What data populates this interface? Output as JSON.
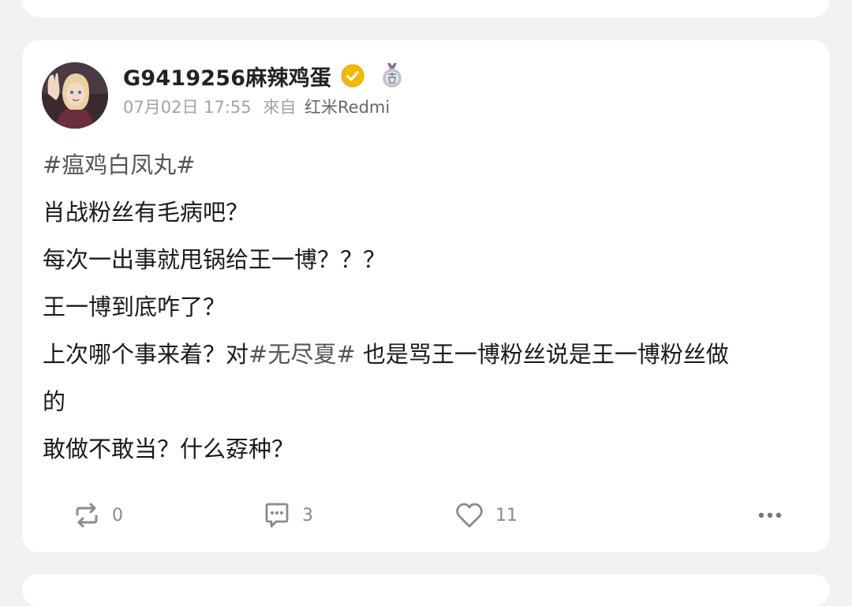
{
  "post": {
    "username": "G9419256麻辣鸡蛋",
    "date": "07月02日 17:55",
    "source_label": "來自",
    "device": "红米Redmi",
    "content": {
      "hashtag1": "#瘟鸡白凤丸#",
      "line2": "肖战粉丝有毛病吧？",
      "line3": "每次一出事就甩锅给王一博？？？",
      "line4": "王一博到底咋了？",
      "line5_before": "上次哪个事来着？对",
      "line5_tag": "#无尽夏#",
      "line5_after": " 也是骂王一博粉丝说是王一博粉丝做",
      "line6": "的",
      "line7": "敢做不敢当？什么孬种？"
    },
    "actions": {
      "repost_count": "0",
      "comment_count": "3",
      "like_count": "11"
    }
  },
  "colors": {
    "background": "#f2f2f2",
    "card": "#ffffff",
    "verified_badge": "#f5b800",
    "meta_text": "#a3a3a3",
    "icon_gray": "#8a8a8a"
  },
  "icons": {
    "verified": "verified-icon",
    "medal": "medal-icon",
    "repost": "repost-icon",
    "comment": "comment-icon",
    "like": "heart-icon",
    "more": "more-icon"
  }
}
